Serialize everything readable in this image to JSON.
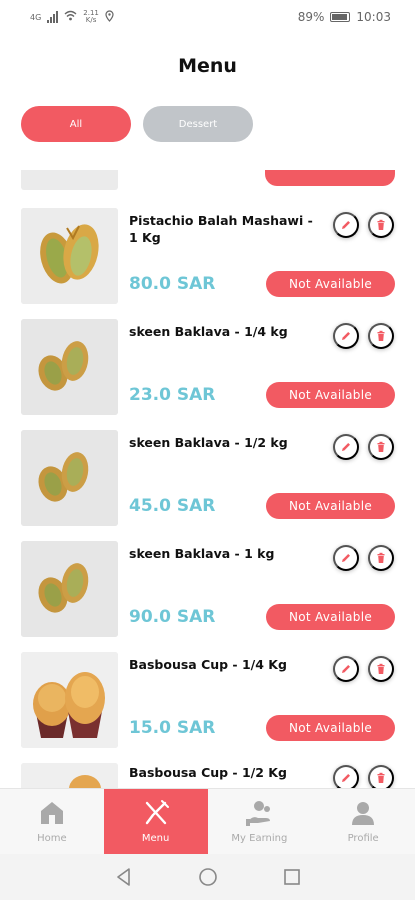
{
  "status_bar": {
    "network": "4G",
    "speed_top": "2.11",
    "speed_bottom": "K/s",
    "battery": "89%",
    "time": "10:03"
  },
  "header": {
    "title": "Menu"
  },
  "filters": [
    {
      "label": "All",
      "active": true
    },
    {
      "label": "Dessert",
      "active": false
    }
  ],
  "items": [
    {
      "name": "Pistachio Balah Mashawi - 1 Kg",
      "price": "80.0 SAR",
      "status": "Not Available",
      "image": "balah-pastry"
    },
    {
      "name": "skeen Baklava - 1/4 kg",
      "price": "23.0 SAR",
      "status": "Not Available",
      "image": "baklava"
    },
    {
      "name": "skeen Baklava - 1/2 kg",
      "price": "45.0 SAR",
      "status": "Not Available",
      "image": "baklava"
    },
    {
      "name": "skeen Baklava - 1 kg",
      "price": "90.0 SAR",
      "status": "Not Available",
      "image": "baklava"
    },
    {
      "name": "Basbousa Cup - 1/4 Kg",
      "price": "15.0 SAR",
      "status": "Not Available",
      "image": "cupcake"
    },
    {
      "name": "Basbousa Cup - 1/2 Kg",
      "image": "cupcake"
    }
  ],
  "bottom_nav": [
    {
      "label": "Home",
      "icon": "home-icon",
      "active": false
    },
    {
      "label": "Menu",
      "icon": "fork-knife-icon",
      "active": true
    },
    {
      "label": "My Earning",
      "icon": "earning-icon",
      "active": false
    },
    {
      "label": "Profile",
      "icon": "profile-icon",
      "active": false
    }
  ],
  "colors": {
    "accent": "#f25a62",
    "price": "#6ec6d6",
    "chip_inactive": "#c1c5c9"
  }
}
